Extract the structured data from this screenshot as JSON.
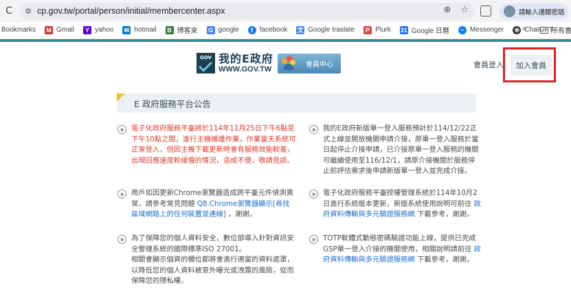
{
  "browser": {
    "url": "cp.gov.tw/portal/person/initial/membercenter.aspx",
    "profile_label": "請輸入通關密語",
    "bookmarks": [
      {
        "label": "Bookmarks",
        "icon": "none",
        "color": ""
      },
      {
        "label": "Gmail",
        "icon": "gmail-icon",
        "color": "#d93025"
      },
      {
        "label": "yahoo",
        "icon": "yahoo-icon",
        "color": "#6001d2"
      },
      {
        "label": "hotmail",
        "icon": "hotmail-icon",
        "color": "#0078d4"
      },
      {
        "label": "博客來",
        "icon": "books-icon",
        "color": "#2e7d32"
      },
      {
        "label": "google",
        "icon": "google-icon",
        "color": "#4285f4"
      },
      {
        "label": "facebook",
        "icon": "facebook-icon",
        "color": "#1877f2"
      },
      {
        "label": "Google traslate",
        "icon": "translate-icon",
        "color": "#4285f4"
      },
      {
        "label": "Plurk",
        "icon": "plurk-icon",
        "color": "#e8413f"
      },
      {
        "label": "Google 日曆",
        "icon": "calendar-icon",
        "color": "#1a73e8"
      },
      {
        "label": "Messenger",
        "icon": "messenger-icon",
        "color": "#0a7cff"
      },
      {
        "label": "ChatGPT",
        "icon": "chatgpt-icon",
        "color": "#333333"
      }
    ],
    "more_label": "»",
    "folder_label": "所有書"
  },
  "header": {
    "logo_badge": "GOV",
    "logo_title": "我的E政府",
    "logo_url": "WWW.GOV.TW",
    "member_center": "會員中心",
    "login_label": "會員登入",
    "join_label": "加入會員"
  },
  "announcements": {
    "title": "E 政府服務平台公告",
    "items": [
      {
        "text": "電子化政府服務平臺將於114年11月25日下午6點至下午10點之間，進行主機維護作業，作業當天系統可正常登入，但因主機下載更新時會有服務效能較差，出現回應速度較緩慢的情況，造成不便，敬請見諒。"
      },
      {
        "text": "我的E政府新版單一登入服務預計於114/12/22正式上線並開放機關申請介接，原單一登入服務於當日起停止介接申請，已介接原單一登入服務的機關可繼續使用至116/12/1，請原介接機關於服務停止前評估需求後申請新版單一登入並完成介接。"
      },
      {
        "text_before": "用戶如因更新Chrome瀏覽器造成跨平臺元件偵測異常，請參考常見問題 ",
        "link": "Q8.Chrome瀏覽器顯示[尋找區域網路上的任何裝置並連線]",
        "text_after": " ，謝謝。"
      },
      {
        "text_before": "電子化政府服務平臺授權管理系統於114年10月2日進行系統版本更新，新版系統使用說明可前往 ",
        "link": "政府資料傳輸與多元驗證服務網",
        "text_after": " 下載參考，謝謝。"
      },
      {
        "text": "為了保障您的個人資料安全，數位部導入針對資訊安全管理系統的國際標準ISO 27001。\n相關會顯示個資的欄位都將會進行適當的資料遮罩，以降低您的個人資料被意外曝光或洩露的風險，從而保障您的隱私權。"
      },
      {
        "text_before": "TOTP軟體式動態密碼驗證功能上線，提供已完成GSP單一登入介接的機關使用，相關說明請前往 ",
        "link": "政府資料傳輸與多元驗證服務網",
        "text_after": " 下載參考，謝謝。"
      }
    ]
  },
  "colors": {
    "accent_teal": "#2e8d95",
    "highlight_red": "#e0201d",
    "announce_red": "#e23b2c",
    "link_blue": "#1d6fd1",
    "corner_yellow": "#f3c322"
  }
}
